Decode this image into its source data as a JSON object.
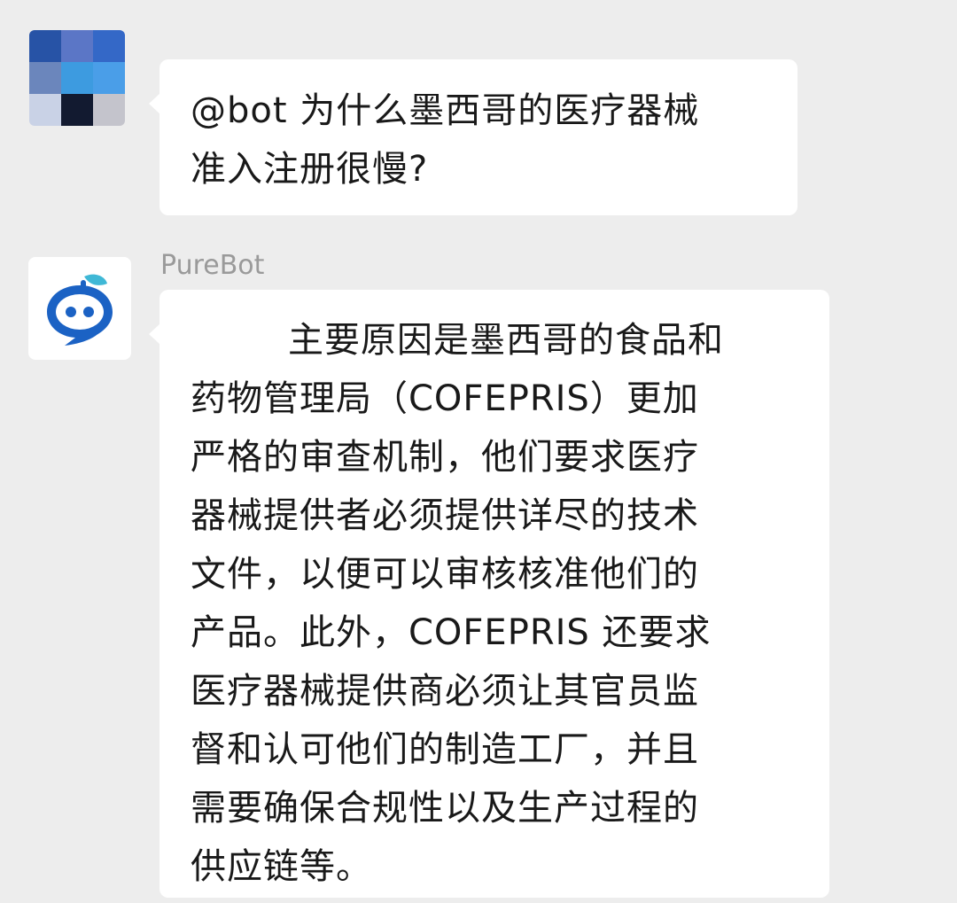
{
  "messages": [
    {
      "role": "user",
      "text": "@bot 为什么墨西哥的医疗器械\n准入注册很慢?"
    },
    {
      "role": "bot",
      "sender": "PureBot",
      "text": "主要原因是墨西哥的食品和\n药物管理局（COFEPRIS）更加\n严格的审查机制，他们要求医疗\n器械提供者必须提供详尽的技术\n文件，以便可以审核核准他们的\n产品。此外，COFEPRIS 还要求\n医疗器械提供商必须让其官员监\n督和认可他们的制造工厂，并且\n需要确保合规性以及生产过程的\n供应链等。"
    }
  ],
  "user_avatar": {
    "icon": "pixelated-avatar-icon",
    "colors": [
      "#2753a6",
      "#5b76c6",
      "#3468c7",
      "#6b86bc",
      "#3d9be0",
      "#4a9ee8",
      "#c9d2e6",
      "#121a30",
      "#c4c4cc"
    ]
  },
  "bot_avatar": {
    "icon": "chat-bot-icon",
    "colors": {
      "primary": "#1b62c4",
      "leaf": "#3fb8d6"
    }
  }
}
